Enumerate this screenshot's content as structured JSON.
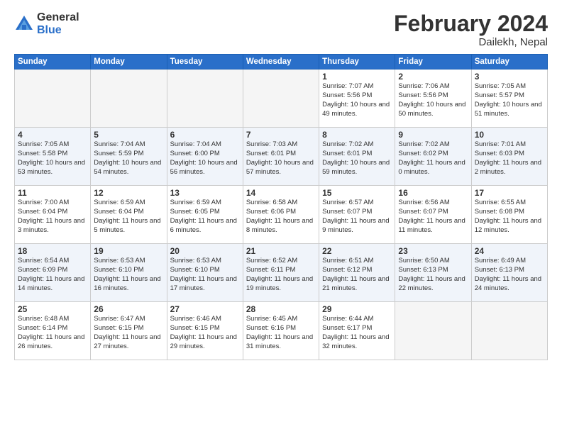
{
  "header": {
    "logo_general": "General",
    "logo_blue": "Blue",
    "month_title": "February 2024",
    "location": "Dailekh, Nepal"
  },
  "weekdays": [
    "Sunday",
    "Monday",
    "Tuesday",
    "Wednesday",
    "Thursday",
    "Friday",
    "Saturday"
  ],
  "weeks": [
    [
      {
        "day": "",
        "detail": ""
      },
      {
        "day": "",
        "detail": ""
      },
      {
        "day": "",
        "detail": ""
      },
      {
        "day": "",
        "detail": ""
      },
      {
        "day": "1",
        "detail": "Sunrise: 7:07 AM\nSunset: 5:56 PM\nDaylight: 10 hours\nand 49 minutes."
      },
      {
        "day": "2",
        "detail": "Sunrise: 7:06 AM\nSunset: 5:56 PM\nDaylight: 10 hours\nand 50 minutes."
      },
      {
        "day": "3",
        "detail": "Sunrise: 7:05 AM\nSunset: 5:57 PM\nDaylight: 10 hours\nand 51 minutes."
      }
    ],
    [
      {
        "day": "4",
        "detail": "Sunrise: 7:05 AM\nSunset: 5:58 PM\nDaylight: 10 hours\nand 53 minutes."
      },
      {
        "day": "5",
        "detail": "Sunrise: 7:04 AM\nSunset: 5:59 PM\nDaylight: 10 hours\nand 54 minutes."
      },
      {
        "day": "6",
        "detail": "Sunrise: 7:04 AM\nSunset: 6:00 PM\nDaylight: 10 hours\nand 56 minutes."
      },
      {
        "day": "7",
        "detail": "Sunrise: 7:03 AM\nSunset: 6:01 PM\nDaylight: 10 hours\nand 57 minutes."
      },
      {
        "day": "8",
        "detail": "Sunrise: 7:02 AM\nSunset: 6:01 PM\nDaylight: 10 hours\nand 59 minutes."
      },
      {
        "day": "9",
        "detail": "Sunrise: 7:02 AM\nSunset: 6:02 PM\nDaylight: 11 hours\nand 0 minutes."
      },
      {
        "day": "10",
        "detail": "Sunrise: 7:01 AM\nSunset: 6:03 PM\nDaylight: 11 hours\nand 2 minutes."
      }
    ],
    [
      {
        "day": "11",
        "detail": "Sunrise: 7:00 AM\nSunset: 6:04 PM\nDaylight: 11 hours\nand 3 minutes."
      },
      {
        "day": "12",
        "detail": "Sunrise: 6:59 AM\nSunset: 6:04 PM\nDaylight: 11 hours\nand 5 minutes."
      },
      {
        "day": "13",
        "detail": "Sunrise: 6:59 AM\nSunset: 6:05 PM\nDaylight: 11 hours\nand 6 minutes."
      },
      {
        "day": "14",
        "detail": "Sunrise: 6:58 AM\nSunset: 6:06 PM\nDaylight: 11 hours\nand 8 minutes."
      },
      {
        "day": "15",
        "detail": "Sunrise: 6:57 AM\nSunset: 6:07 PM\nDaylight: 11 hours\nand 9 minutes."
      },
      {
        "day": "16",
        "detail": "Sunrise: 6:56 AM\nSunset: 6:07 PM\nDaylight: 11 hours\nand 11 minutes."
      },
      {
        "day": "17",
        "detail": "Sunrise: 6:55 AM\nSunset: 6:08 PM\nDaylight: 11 hours\nand 12 minutes."
      }
    ],
    [
      {
        "day": "18",
        "detail": "Sunrise: 6:54 AM\nSunset: 6:09 PM\nDaylight: 11 hours\nand 14 minutes."
      },
      {
        "day": "19",
        "detail": "Sunrise: 6:53 AM\nSunset: 6:10 PM\nDaylight: 11 hours\nand 16 minutes."
      },
      {
        "day": "20",
        "detail": "Sunrise: 6:53 AM\nSunset: 6:10 PM\nDaylight: 11 hours\nand 17 minutes."
      },
      {
        "day": "21",
        "detail": "Sunrise: 6:52 AM\nSunset: 6:11 PM\nDaylight: 11 hours\nand 19 minutes."
      },
      {
        "day": "22",
        "detail": "Sunrise: 6:51 AM\nSunset: 6:12 PM\nDaylight: 11 hours\nand 21 minutes."
      },
      {
        "day": "23",
        "detail": "Sunrise: 6:50 AM\nSunset: 6:13 PM\nDaylight: 11 hours\nand 22 minutes."
      },
      {
        "day": "24",
        "detail": "Sunrise: 6:49 AM\nSunset: 6:13 PM\nDaylight: 11 hours\nand 24 minutes."
      }
    ],
    [
      {
        "day": "25",
        "detail": "Sunrise: 6:48 AM\nSunset: 6:14 PM\nDaylight: 11 hours\nand 26 minutes."
      },
      {
        "day": "26",
        "detail": "Sunrise: 6:47 AM\nSunset: 6:15 PM\nDaylight: 11 hours\nand 27 minutes."
      },
      {
        "day": "27",
        "detail": "Sunrise: 6:46 AM\nSunset: 6:15 PM\nDaylight: 11 hours\nand 29 minutes."
      },
      {
        "day": "28",
        "detail": "Sunrise: 6:45 AM\nSunset: 6:16 PM\nDaylight: 11 hours\nand 31 minutes."
      },
      {
        "day": "29",
        "detail": "Sunrise: 6:44 AM\nSunset: 6:17 PM\nDaylight: 11 hours\nand 32 minutes."
      },
      {
        "day": "",
        "detail": ""
      },
      {
        "day": "",
        "detail": ""
      }
    ]
  ]
}
